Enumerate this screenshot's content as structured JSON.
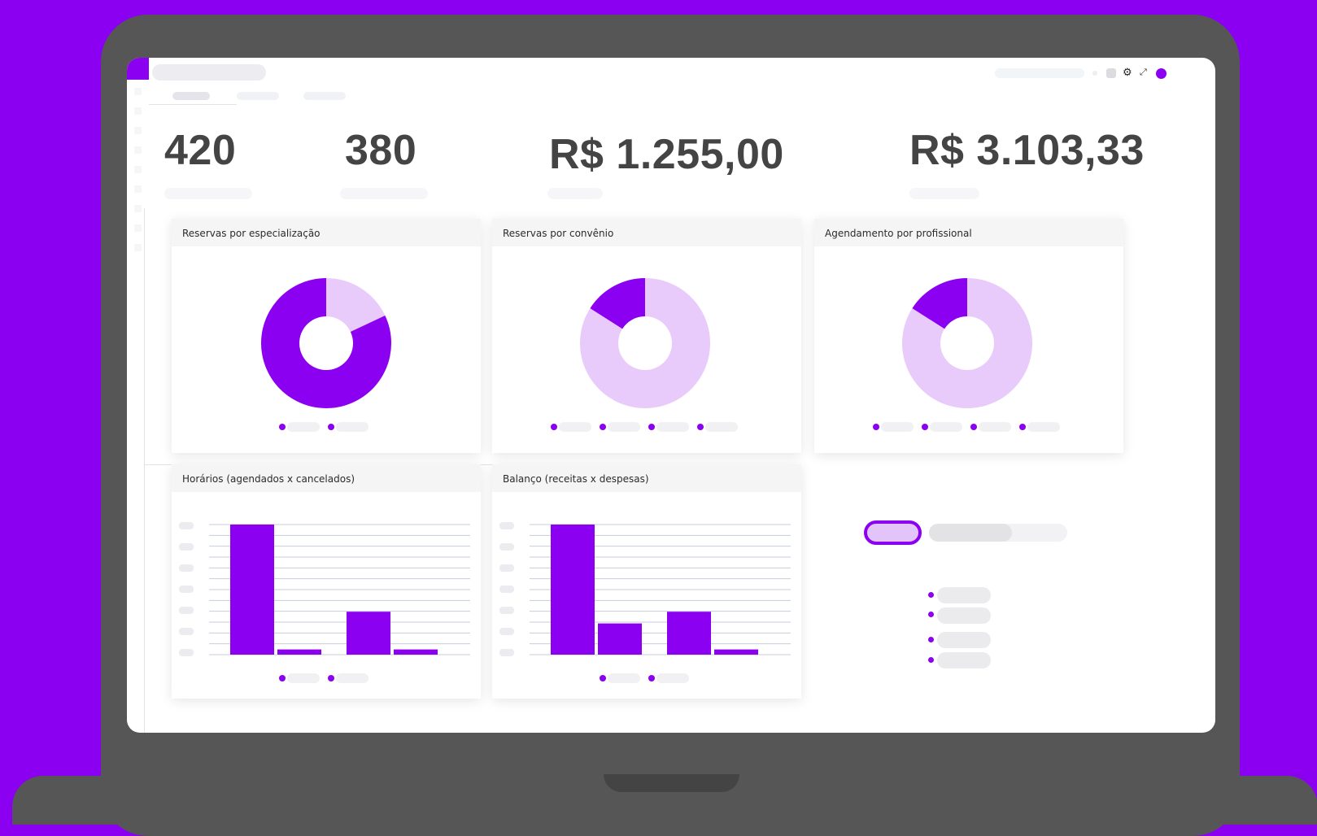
{
  "colors": {
    "accent": "#8c00f2",
    "accent_light": "#e8cbfb",
    "grid": "#c7ced8",
    "laptop": "#565656"
  },
  "header": {
    "icons": [
      "status-icon",
      "square-icon",
      "gear-icon",
      "expand-icon",
      "avatar"
    ]
  },
  "stats": [
    {
      "value": "420"
    },
    {
      "value": "380"
    },
    {
      "value": "R$ 1.255,00"
    },
    {
      "value": "R$ 3.103,33"
    }
  ],
  "cards": {
    "especializacao": {
      "title": "Reservas por especialização"
    },
    "convenio": {
      "title": "Reservas por convênio"
    },
    "profissional": {
      "title": "Agendamento por profissional"
    },
    "horarios": {
      "title": "Horários (agendados x cancelados)"
    },
    "balanco": {
      "title": "Balanço (receitas x despesas)"
    }
  },
  "chart_data": [
    {
      "type": "pie",
      "title": "Reservas por especialização",
      "values": [
        18,
        82
      ],
      "colors": [
        "#e8cbfb",
        "#8c00f2"
      ],
      "legend_count": 2
    },
    {
      "type": "pie",
      "title": "Reservas por convênio",
      "values": [
        84,
        16
      ],
      "colors": [
        "#e8cbfb",
        "#8c00f2"
      ],
      "legend_count": 4
    },
    {
      "type": "pie",
      "title": "Agendamento por profissional",
      "values": [
        84,
        16
      ],
      "colors": [
        "#e8cbfb",
        "#8c00f2"
      ],
      "legend_count": 4
    },
    {
      "type": "bar",
      "title": "Horários (agendados x cancelados)",
      "values": [
        100,
        4,
        33,
        4
      ],
      "ylim": [
        0,
        100
      ],
      "gridlines": 12,
      "legend_count": 2
    },
    {
      "type": "bar",
      "title": "Balanço (receitas x despesas)",
      "values": [
        100,
        24,
        33,
        4
      ],
      "ylim": [
        0,
        100
      ],
      "gridlines": 12,
      "legend_count": 2
    }
  ]
}
